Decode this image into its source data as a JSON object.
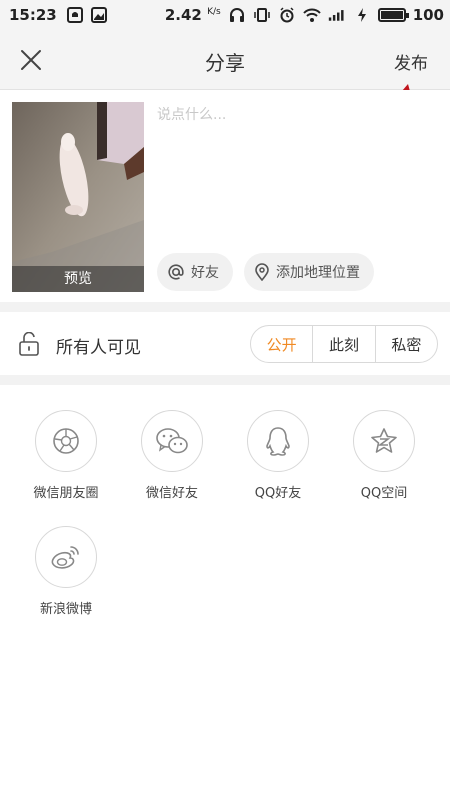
{
  "status_bar": {
    "time": "15:23",
    "net_speed": "2.42",
    "net_unit": "K/s",
    "battery_text": "100",
    "battery_level": 1.0,
    "icons": [
      "notification-icon",
      "image-notification-icon",
      "headphones-icon",
      "vibrate-icon",
      "alarm-icon",
      "wifi-icon",
      "signal-icon",
      "charging-icon",
      "battery-icon"
    ]
  },
  "header": {
    "title": "分享",
    "publish_label": "发布",
    "close_icon": "close-icon"
  },
  "annotation": {
    "color": "#c0141c"
  },
  "compose": {
    "preview_label": "预览",
    "placeholder": "说点什么...",
    "text_value": "",
    "mention_label": "好友",
    "location_label": "添加地理位置"
  },
  "visibility": {
    "label": "所有人可见",
    "options": [
      "公开",
      "此刻",
      "私密"
    ],
    "selected": "公开",
    "accent_color": "#f08a24"
  },
  "share_targets": [
    {
      "label": "微信朋友圈",
      "icon": "wechat-moments-icon"
    },
    {
      "label": "微信好友",
      "icon": "wechat-icon"
    },
    {
      "label": "QQ好友",
      "icon": "qq-icon"
    },
    {
      "label": "QQ空间",
      "icon": "qzone-icon"
    },
    {
      "label": "新浪微博",
      "icon": "weibo-icon"
    }
  ]
}
